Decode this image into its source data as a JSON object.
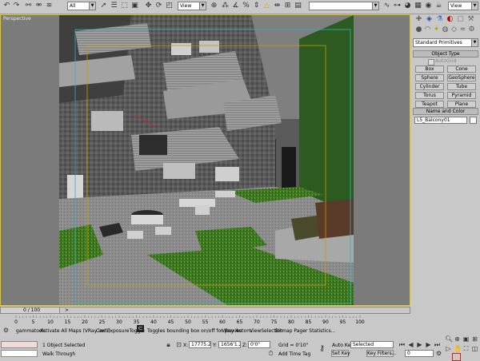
{
  "toolbar": {
    "selection_filter": "All",
    "ref_coord_1": "View",
    "ref_coord_2": "View",
    "right_combo": "View",
    "icons": [
      "undo-icon",
      "redo-icon",
      "link-icon",
      "unlink-icon",
      "bind-spacewarp-icon",
      "select-icon",
      "select-by-name-icon",
      "rect-select-icon",
      "window-crossing-icon",
      "move-icon",
      "rotate-icon",
      "scale-icon",
      "pivot-icon",
      "snap-icon",
      "angle-snap-icon",
      "percent-snap-icon",
      "spinner-snap-icon",
      "named-selection-icon",
      "mirror-icon",
      "align-icon",
      "layer-icon",
      "curve-editor-icon",
      "schematic-icon",
      "material-editor-icon",
      "render-setup-icon",
      "render-icon",
      "quick-render-icon"
    ]
  },
  "viewport": {
    "label": "Perspective",
    "object_name_tag": "L5_Balcony01"
  },
  "panel": {
    "tabs": [
      "create-tab",
      "modify-tab",
      "hierarchy-tab",
      "motion-tab",
      "display-tab",
      "utilities-tab"
    ],
    "category_dropdown": "Standard Primitives",
    "object_type_header": "Object Type",
    "autogrid_label": "AutoGrid",
    "buttons": [
      "Box",
      "Cone",
      "Sphere",
      "GeoSphere",
      "Cylinder",
      "Tube",
      "Torus",
      "Pyramid",
      "Teapot",
      "Plane"
    ],
    "name_color_header": "Name and Color",
    "object_name": "L5_Balcony01",
    "object_color": "#ffffff"
  },
  "timeline": {
    "frame_display": "0 / 100",
    "ticks": [
      "0",
      "5",
      "10",
      "15",
      "20",
      "25",
      "30",
      "35",
      "40",
      "45",
      "50",
      "55",
      "60",
      "65",
      "70",
      "75",
      "80",
      "85",
      "90",
      "95",
      "100"
    ]
  },
  "status": {
    "script_items": [
      "gammatools",
      "Activate All Maps (VRay incl.)",
      "CamExposureToggle",
      "Toggles bounding box on/off for proxies",
      "VRay Autom.",
      "ViewSelection",
      "Bitmap Pager Statistics..."
    ],
    "selection_count": "1 Object Selected",
    "prompt": "Walk Through",
    "x_label": "X:",
    "x_value": "17775.25'",
    "y_label": "Y:",
    "y_value": "1656'1.21",
    "z_label": "Z:",
    "z_value": "0'0\"",
    "grid": "Grid = 0'10\"",
    "add_time_tag": "Add Time Tag",
    "auto_key": "Auto Key",
    "set_key": "Set Key",
    "key_mode": "Selected",
    "key_filters": "Key Filters...",
    "current_frame": "0"
  }
}
